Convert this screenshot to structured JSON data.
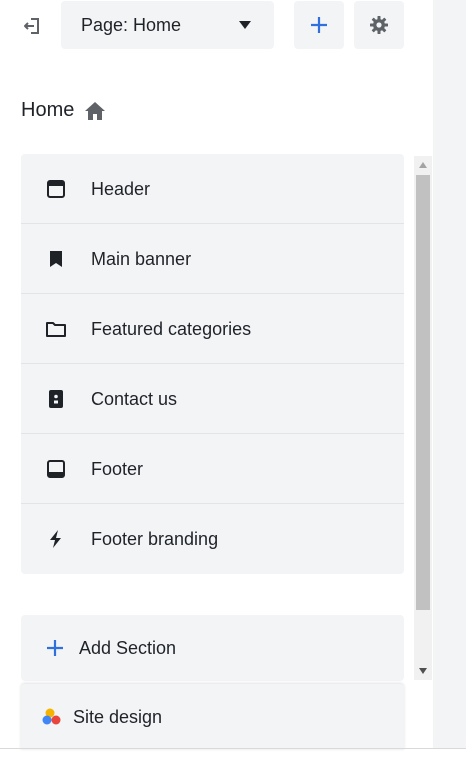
{
  "toolbar": {
    "exit_icon": "exit-icon",
    "page_select_label": "Page: Home",
    "page_select_icon": "caret-down-icon",
    "add_icon": "plus-icon",
    "settings_icon": "gear-icon"
  },
  "page": {
    "title": "Home",
    "title_icon": "home-icon"
  },
  "sections": [
    {
      "label": "Header",
      "icon": "header-layout-icon"
    },
    {
      "label": "Main banner",
      "icon": "bookmark-icon"
    },
    {
      "label": "Featured categories",
      "icon": "folder-icon"
    },
    {
      "label": "Contact us",
      "icon": "contact-card-icon"
    },
    {
      "label": "Footer",
      "icon": "footer-layout-icon"
    },
    {
      "label": "Footer branding",
      "icon": "lightning-icon"
    }
  ],
  "add_section": {
    "label": "Add Section",
    "icon": "plus-icon"
  },
  "site_design": {
    "label": "Site design",
    "icon": "palette-dots-icon"
  },
  "colors": {
    "accent": "#2f6fde",
    "icon": "#1f2328",
    "muted_icon": "#5f6368",
    "panel_bg": "#f3f4f6",
    "dot_yellow": "#f4b400",
    "dot_blue": "#4285f4",
    "dot_red": "#e8453c"
  }
}
